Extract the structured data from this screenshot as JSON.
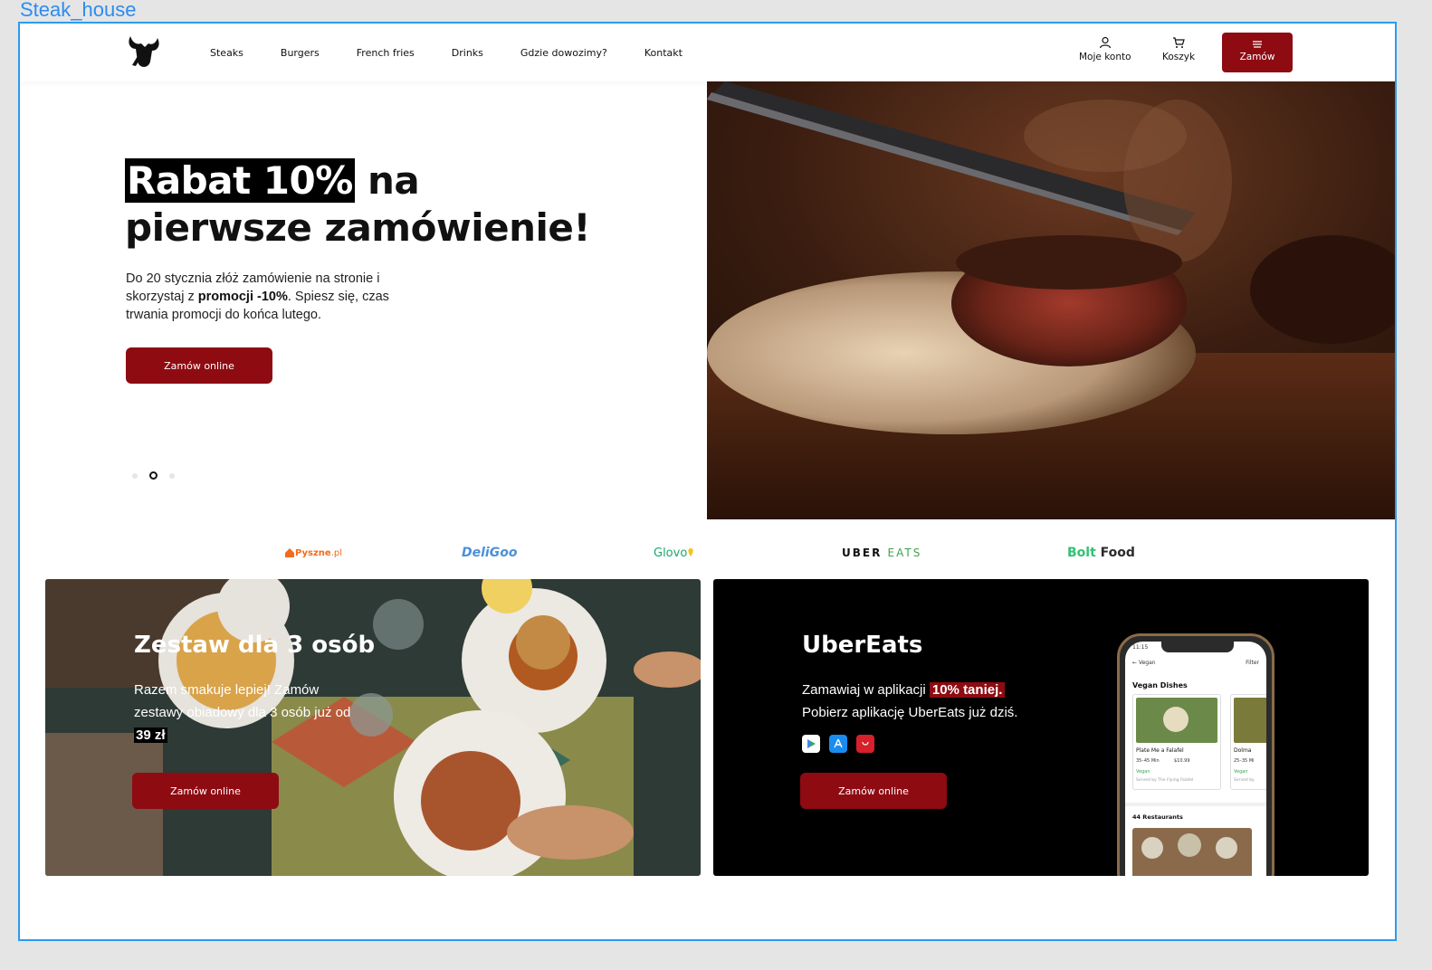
{
  "frame": {
    "label": "Steak_house"
  },
  "header": {
    "nav": [
      "Steaks",
      "Burgers",
      "French fries",
      "Drinks",
      "Gdzie dowozimy?",
      "Kontakt"
    ],
    "account_label": "Moje konto",
    "cart_label": "Koszyk",
    "order_label": "Zamów"
  },
  "hero": {
    "title_highlight": "Rabat 10%",
    "title_rest_1": " na",
    "title_line_2": "pierwsze zamówienie!",
    "text_1": "Do 20 stycznia złóż zamówienie na stronie i skorzystaj z ",
    "text_bold": "promocji -10%",
    "text_2": ". Spiesz się, czas trwania promocji do końca lutego.",
    "button": "Zamów online",
    "slides": 3,
    "active_slide": 2
  },
  "partners": {
    "pyszne": "Pyszne",
    "pyszne_suffix": ".pl",
    "deligoo": "DeliGoo",
    "glovo": "Glovo",
    "uber": "UBER",
    "uber_eats": "EATS",
    "bolt": "Bolt",
    "bolt_food": "Food"
  },
  "card_set": {
    "title": "Zestaw dla 3 osób",
    "text": "Razem smakuje lepiej! Zamów zestawy obiadowy dla 3 osób już od ",
    "price": "39 zł",
    "button": "Zamów online"
  },
  "card_uber": {
    "title": "UberEats",
    "text_1": "Zamawiaj w aplikacji ",
    "text_highlight": "10% taniej.",
    "text_2": "Pobierz aplikację UberEats już dziś.",
    "button": "Zamów online",
    "stores": [
      "google-play-icon",
      "app-store-icon",
      "huawei-appgallery-icon"
    ]
  },
  "phone": {
    "time": "11:15",
    "back_label": "Vegan",
    "filter_label": "Filter",
    "section": "Vegan Dishes",
    "dish_1": "Plate Me a Falafel",
    "dish_1_meta_time": "35–45 Min",
    "dish_1_meta_price": "$10.99",
    "dish_1_tag": "Vegan",
    "dish_1_served": "Served by The Flying Falafel",
    "dish_2": "Dolma",
    "dish_2_meta": "25–35 Mi",
    "dish_2_tag": "Vegan",
    "dish_2_served": "Served by",
    "restaurants": "44 Restaurants"
  },
  "colors": {
    "brand_red": "#8e0b12",
    "frame_blue": "#2d9bf0"
  }
}
